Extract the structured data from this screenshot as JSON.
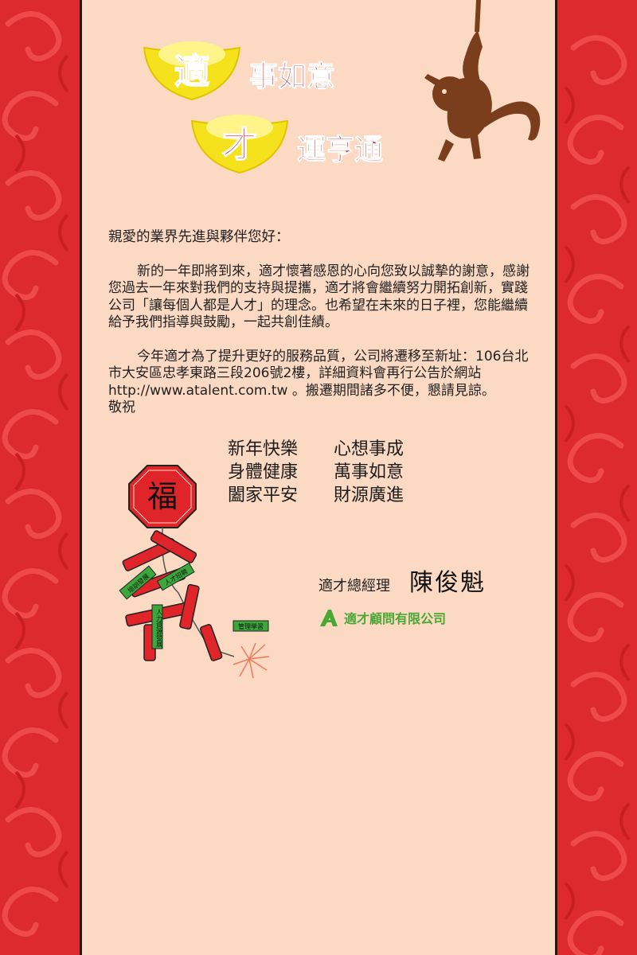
{
  "header": {
    "line1_badge": "適",
    "line1_text": "事如意",
    "line2_badge": "才",
    "line2_text": "運亨通"
  },
  "letter": {
    "greeting": "親愛的業界先進與夥伴您好：",
    "paragraph1": "新的一年即將到來，適才懷著感恩的心向您致以誠摯的謝意，感謝您過去一年來對我們的支持與提攜，適才將會繼續努力開拓創新，實踐公司「讓每個人都是人才」的理念。也希望在未來的日子裡，您能繼續給予我們指導與鼓勵，一起共創佳績。",
    "paragraph2": "今年適才為了提升更好的服務品質，公司將遷移至新址：106台北市大安區忠孝東路三段206號2樓，詳細資料會再行公告於網站 http://www.atalent.com.tw 。搬遷期間諸多不便，懇請見諒。",
    "closing": "敬祝"
  },
  "wishes": [
    [
      "新年快樂",
      "心想事成"
    ],
    [
      "身體健康",
      "萬事如意"
    ],
    [
      "闔家平安",
      "財源廣進"
    ]
  ],
  "firecracker": {
    "fu": "福",
    "labels": [
      "培訓發展",
      "人才招聘",
      "人力資源發展",
      "管理學習"
    ]
  },
  "signature": {
    "title": "適才總經理",
    "name": "陳俊魁"
  },
  "company": {
    "name": "適才顧問有限公司",
    "logo_color": "#4aa832"
  },
  "colors": {
    "border_red": "#d7262a",
    "card_bg": "#fbd9c3",
    "ingot_gold": "#f5e11a",
    "title_red": "#d01c24"
  }
}
